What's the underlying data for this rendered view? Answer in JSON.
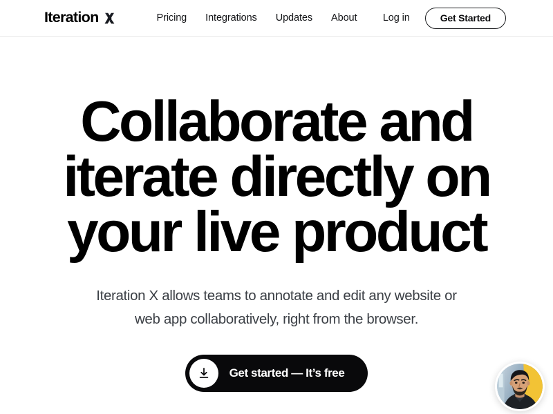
{
  "header": {
    "brand": {
      "word": "Iteration",
      "mark_icon": "x-logo-icon"
    },
    "nav": [
      {
        "label": "Pricing"
      },
      {
        "label": "Integrations"
      },
      {
        "label": "Updates"
      },
      {
        "label": "About"
      }
    ],
    "actions": {
      "login_label": "Log in",
      "get_started_label": "Get Started"
    }
  },
  "hero": {
    "title_lines": [
      "Collaborate and",
      "iterate directly on",
      "your live product"
    ],
    "subtitle_lines": [
      "Iteration X allows teams to annotate and edit any website or",
      "web app collaboratively, right from the browser."
    ],
    "cta": {
      "label": "Get started — It’s free",
      "icon": "download-icon"
    }
  },
  "widget": {
    "avatar_alt": "support-agent-avatar"
  },
  "colors": {
    "background": "#ffffff",
    "text_primary": "#000000",
    "text_secondary": "#3c4046",
    "cta_background": "#09090b",
    "cta_text": "#ffffff",
    "header_border": "#e9e9ea",
    "avatar_bg_yellow": "#f2c335",
    "avatar_bg_blue": "#5f86ad"
  }
}
